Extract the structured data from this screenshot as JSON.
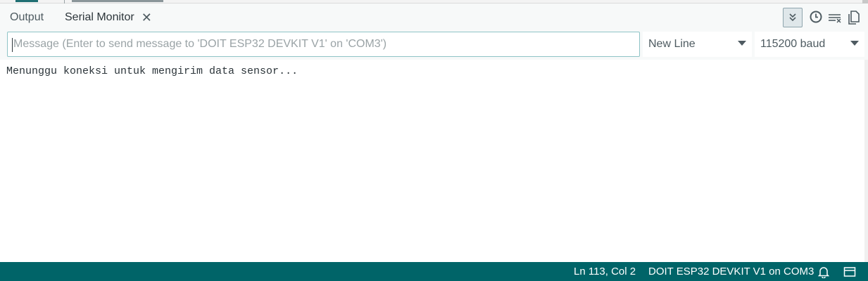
{
  "tabs": {
    "output_label": "Output",
    "serial_monitor_label": "Serial Monitor",
    "close_glyph": "✕"
  },
  "toolbar": {
    "autoscroll_icon": "double-chevron-down-icon",
    "timestamp_icon": "clock-icon",
    "clear_icon": "clear-output-icon",
    "copy_icon": "copy-icon"
  },
  "input": {
    "value": "",
    "placeholder": "Message (Enter to send message to 'DOIT ESP32 DEVKIT V1' on 'COM3')"
  },
  "line_ending": {
    "selected": "New Line"
  },
  "baud_rate": {
    "selected": "115200 baud"
  },
  "output": {
    "lines": [
      "Menunggu koneksi untuk mengirim data sensor..."
    ]
  },
  "status_bar": {
    "position": "Ln 113, Col 2",
    "board": "DOIT ESP32 DEVKIT V1 on COM3"
  },
  "colors": {
    "status_bar_bg": "#006468",
    "accent_border": "#8fc4c6",
    "text": "#4e5b61"
  }
}
